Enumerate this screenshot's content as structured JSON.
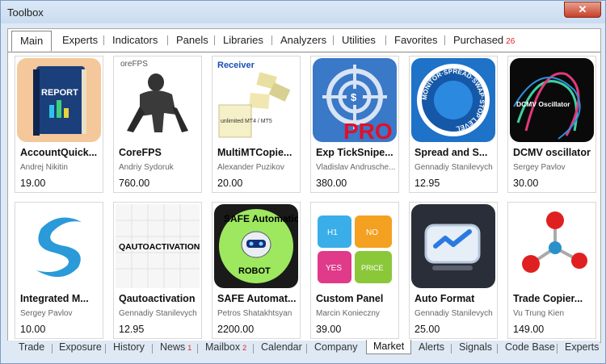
{
  "window": {
    "title": "Toolbox",
    "close_icon": "close-icon"
  },
  "top_tabs": [
    {
      "label": "Main"
    },
    {
      "label": "Experts"
    },
    {
      "label": "Indicators"
    },
    {
      "label": "Panels"
    },
    {
      "label": "Libraries"
    },
    {
      "label": "Analyzers"
    },
    {
      "label": "Utilities"
    },
    {
      "label": "Favorites"
    },
    {
      "label": "Purchased",
      "badge": "26"
    }
  ],
  "products": [
    {
      "name": "AccountQuick...",
      "author": "Andrej Nikitin",
      "price": "19.00",
      "thumb_text": "REPORT"
    },
    {
      "name": "CoreFPS",
      "author": "Andriy Sydoruk",
      "price": "760.00",
      "thumb_text": "oreFPS"
    },
    {
      "name": "MultiMTCopie...",
      "author": "Alexander Puzikov",
      "price": "20.00",
      "thumb_text": "Receiver",
      "thumb_text2": "unlimited MT4 / MT5"
    },
    {
      "name": "Exp TickSnipe...",
      "author": "Vladislav Andrusche...",
      "price": "380.00",
      "thumb_text": "PRO"
    },
    {
      "name": "Spread and S...",
      "author": "Gennadiy Stanilevych",
      "price": "12.95",
      "thumb_text": "MONITOR·SPREAD·SWAP·STOP LEVEL"
    },
    {
      "name": "DCMV oscillator",
      "author": "Sergey Pavlov",
      "price": "30.00",
      "thumb_text": "DCMV Oscillator"
    },
    {
      "name": "Integrated M...",
      "author": "Sergey Pavlov",
      "price": "10.00"
    },
    {
      "name": "Qautoactivation",
      "author": "Gennadiy Stanilevych",
      "price": "12.95",
      "thumb_text": "QAUTOACTIVATION"
    },
    {
      "name": "SAFE Automat...",
      "author": "Petros Shatakhtsyan",
      "price": "2200.00",
      "thumb_text": "SAFE Automatic",
      "thumb_text2": "ROBOT"
    },
    {
      "name": "Custom Panel",
      "author": "Marcin Konieczny",
      "price": "39.00",
      "puzzle": [
        "H1",
        "NO",
        "YES",
        "PRICE"
      ]
    },
    {
      "name": "Auto Format",
      "author": "Gennadiy Stanilevych",
      "price": "25.00"
    },
    {
      "name": "Trade Copier...",
      "author": "Vu Trung Kien",
      "price": "149.00"
    }
  ],
  "bottom_tabs": [
    {
      "label": "Trade"
    },
    {
      "label": "Exposure"
    },
    {
      "label": "History"
    },
    {
      "label": "News",
      "badge": "1"
    },
    {
      "label": "Mailbox",
      "badge": "2"
    },
    {
      "label": "Calendar"
    },
    {
      "label": "Company"
    },
    {
      "label": "Market"
    },
    {
      "label": "Alerts"
    },
    {
      "label": "Signals"
    },
    {
      "label": "Code Base"
    },
    {
      "label": "Experts"
    }
  ],
  "active_top_tab": "Main",
  "active_bottom_tab": "Market"
}
